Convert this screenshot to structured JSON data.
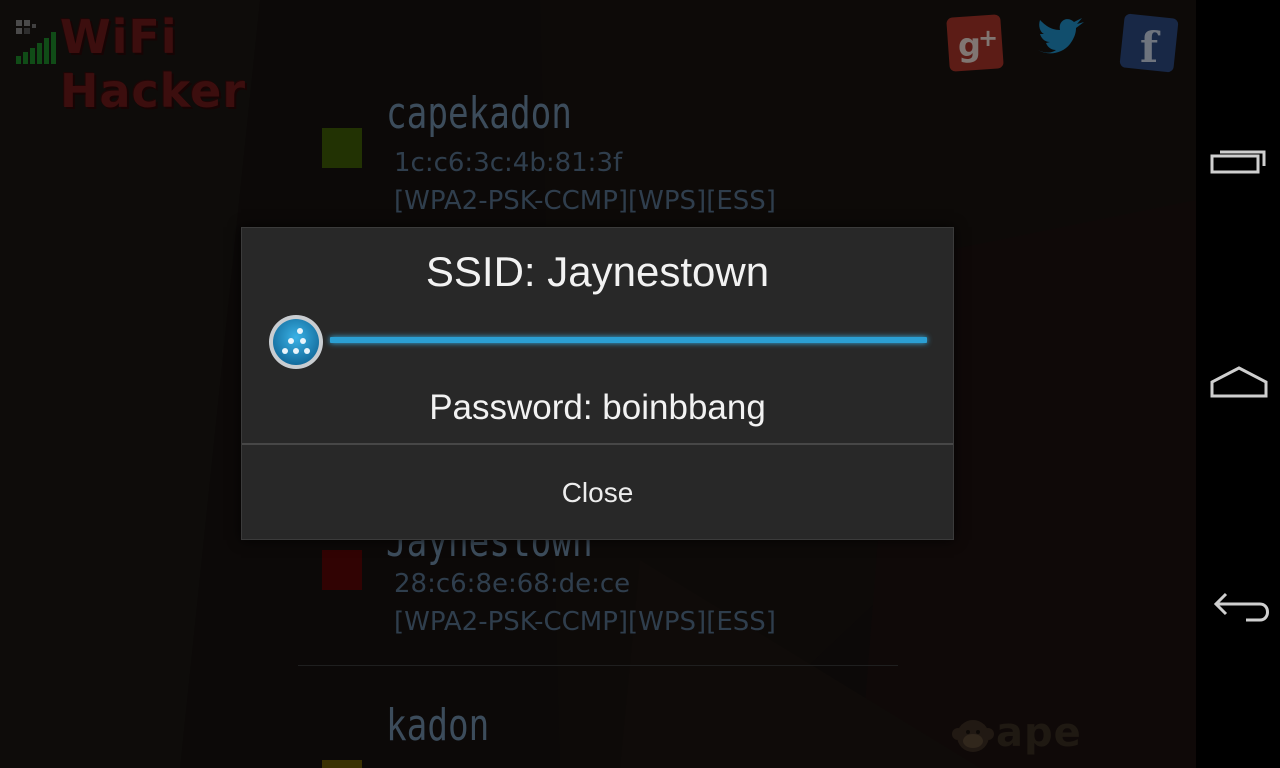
{
  "app": {
    "title": "WiFi Hacker",
    "colors": {
      "accent": "#2b9fd3",
      "title": "#6e1a1a"
    }
  },
  "header": {
    "social": [
      {
        "name": "google-plus-icon",
        "label": "g+"
      },
      {
        "name": "twitter-icon",
        "label": "twitter"
      },
      {
        "name": "facebook-icon",
        "label": "f"
      }
    ]
  },
  "networks": [
    {
      "ssid": "capekadon",
      "mac": "1c:c6:3c:4b:81:3f",
      "caps": "[WPA2-PSK-CCMP][WPS][ESS]",
      "color": "#3e5c06"
    },
    {
      "ssid": "Jaynestown",
      "mac": "28:c6:8e:68:de:ce",
      "caps": "[WPA2-PSK-CCMP][WPS][ESS]",
      "color": "#5a0606"
    },
    {
      "ssid": "kadon",
      "color": "#6b5a06"
    }
  ],
  "dialog": {
    "title": "SSID: Jaynestown",
    "password": "Password: boinbbang",
    "close_label": "Close",
    "progress": 1.0
  },
  "watermark": {
    "text": "ape apps"
  },
  "navbar": {
    "buttons": [
      "recent-apps",
      "home",
      "back"
    ]
  }
}
